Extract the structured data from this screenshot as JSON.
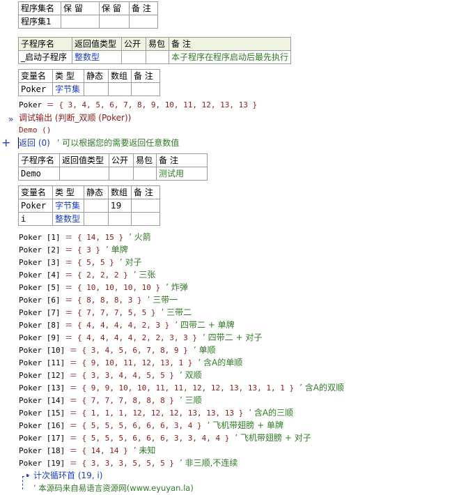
{
  "assembly_table": {
    "headers": [
      "程序集名",
      "保 留",
      "保 留",
      "备 注"
    ],
    "row": [
      "程序集1",
      "",
      "",
      ""
    ]
  },
  "sub1_table": {
    "headers": [
      "子程序名",
      "返回值类型",
      "公开",
      "易包",
      "备 注"
    ],
    "row": [
      "_启动子程序",
      "整数型",
      "",
      "",
      "本子程序在程序启动后最先执行"
    ]
  },
  "var1_table": {
    "headers": [
      "变量名",
      "类 型",
      "静态",
      "数组",
      "备 注"
    ],
    "row": [
      "Poker",
      "字节集",
      "",
      "",
      ""
    ]
  },
  "code1": {
    "line1": "Poker ＝ { 3, 4, 5, 6, 7, 8, 9, 10, 11, 12, 13, 13 }",
    "line2_fn": "调试输出 (判断_双顺 (Poker))",
    "line3": "Demo ()",
    "line4_kw": "返回 (0)",
    "line4_cm": "’ 可以根据您的需要返回任意数值"
  },
  "sub2_table": {
    "headers": [
      "子程序名",
      "返回值类型",
      "公开",
      "易包",
      "备 注"
    ],
    "row": [
      "Demo",
      "",
      "",
      "",
      "测试用"
    ]
  },
  "var2_table": {
    "headers": [
      "变量名",
      "类 型",
      "静态",
      "数组",
      "备 注"
    ],
    "rows": [
      [
        "Poker",
        "字节集",
        "",
        "19",
        ""
      ],
      [
        "i",
        "整数型",
        "",
        "",
        ""
      ]
    ]
  },
  "poker_lines": [
    {
      "lhs": "Poker [1] ＝ { 14, 15 }",
      "cm": "’ 火箭"
    },
    {
      "lhs": "Poker [2] ＝ { 3 }",
      "cm": "’ 单牌"
    },
    {
      "lhs": "Poker [3] ＝ { 5, 5 }",
      "cm": "’ 对子"
    },
    {
      "lhs": "Poker [4] ＝ { 2, 2, 2 }",
      "cm": "’ 三张"
    },
    {
      "lhs": "Poker [5] ＝ { 10, 10, 10, 10 }",
      "cm": "’ 炸弹"
    },
    {
      "lhs": "Poker [6] ＝ { 8, 8, 8, 3 }",
      "cm": "’ 三带一"
    },
    {
      "lhs": "Poker [7] ＝ { 7, 7, 7, 5, 5 }",
      "cm": "’ 三带二"
    },
    {
      "lhs": "Poker [8] ＝ { 4, 4, 4, 4, 2, 3 }",
      "cm": "’ 四带二 + 单牌"
    },
    {
      "lhs": "Poker [9] ＝ { 4, 4, 4, 4, 2, 2, 3, 3 }",
      "cm": "’ 四带二 + 对子"
    },
    {
      "lhs": "Poker [10] ＝ { 3, 4, 5, 6, 7, 8, 9 }",
      "cm": "’ 单顺"
    },
    {
      "lhs": "Poker [11] ＝ { 9, 10, 11, 12, 13, 1 }",
      "cm": "’ 含A的单顺"
    },
    {
      "lhs": "Poker [12] ＝ { 3, 3, 4, 4, 5, 5 }",
      "cm": "’ 双顺"
    },
    {
      "lhs": "Poker [13] ＝ { 9, 9, 10, 10, 11, 11, 12, 12, 13, 13, 1, 1 }",
      "cm": "’ 含A的双顺"
    },
    {
      "lhs": "Poker [14] ＝ { 7, 7, 7, 8, 8, 8 }",
      "cm": "’ 三顺"
    },
    {
      "lhs": "Poker [15] ＝ { 1, 1, 1, 12, 12, 12, 13, 13, 13 }",
      "cm": "’ 含A的三顺"
    },
    {
      "lhs": "Poker [16] ＝ { 5, 5, 5, 6, 6, 6, 3, 4 }",
      "cm": "’ 飞机带翅膀 + 单牌"
    },
    {
      "lhs": "Poker [17] ＝ { 5, 5, 5, 6, 6, 6, 3, 3, 4, 4 }",
      "cm": "’ 飞机带翅膀 + 对子"
    },
    {
      "lhs": "Poker [18] ＝ { 14, 14 }",
      "cm": "’ 未知"
    },
    {
      "lhs": "Poker [19] ＝ { 3, 3, 3, 5, 5, 5 }",
      "cm": "’ 非三顺,不连续"
    }
  ],
  "loop_line": "计次循环首 (19, i)",
  "footer_comment": "’ 本源码来自易语言资源网(www.eyuyan.la)",
  "gutter": {
    "arrow": "»",
    "plus": "+"
  }
}
